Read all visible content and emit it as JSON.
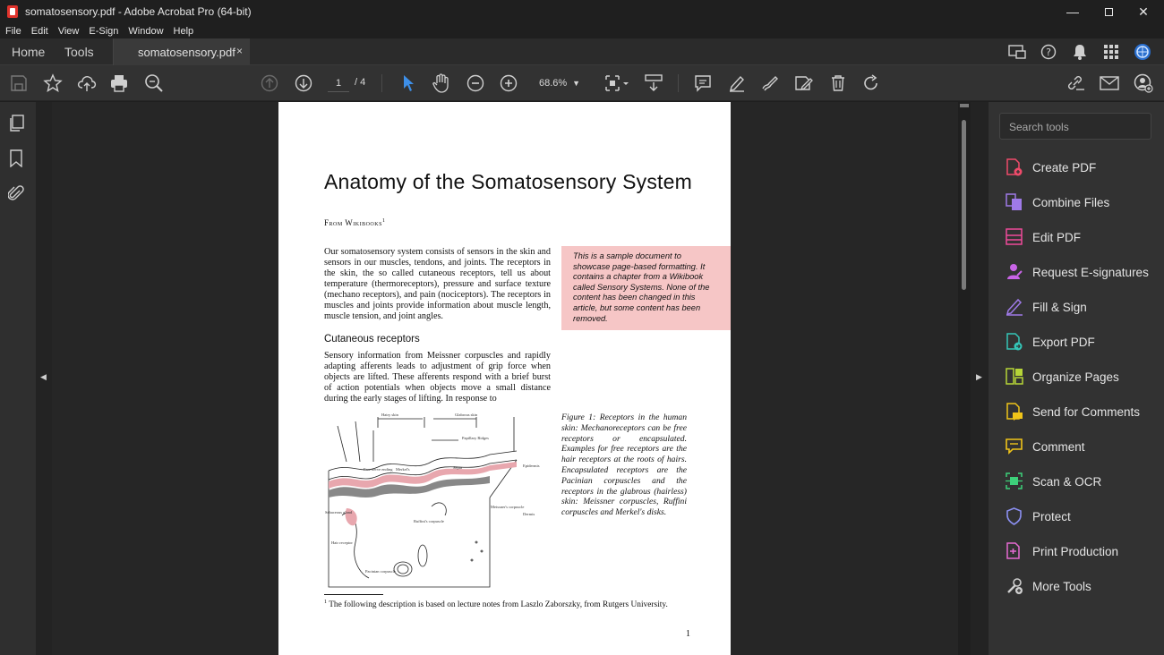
{
  "window": {
    "title": "somatosensory.pdf - Adobe Acrobat Pro (64-bit)"
  },
  "menu": [
    "File",
    "Edit",
    "View",
    "E-Sign",
    "Window",
    "Help"
  ],
  "tabs": {
    "home": "Home",
    "tools": "Tools",
    "document": "somatosensory.pdf",
    "close": "×"
  },
  "toolbar": {
    "page_current": "1",
    "page_total": "/ 4",
    "zoom": "68.6%"
  },
  "right_panel": {
    "search_placeholder": "Search tools",
    "tools": [
      {
        "label": "Create PDF",
        "icon": "create-pdf-icon",
        "color": "#ef4b6b"
      },
      {
        "label": "Combine Files",
        "icon": "combine-files-icon",
        "color": "#9f7ae8"
      },
      {
        "label": "Edit PDF",
        "icon": "edit-pdf-icon",
        "color": "#ef4b9a"
      },
      {
        "label": "Request E-signatures",
        "icon": "e-signature-icon",
        "color": "#c864e6"
      },
      {
        "label": "Fill & Sign",
        "icon": "fill-sign-icon",
        "color": "#9f7ae8"
      },
      {
        "label": "Export PDF",
        "icon": "export-pdf-icon",
        "color": "#34c6b8"
      },
      {
        "label": "Organize Pages",
        "icon": "organize-pages-icon",
        "color": "#b6d438"
      },
      {
        "label": "Send for Comments",
        "icon": "send-comments-icon",
        "color": "#f0c419"
      },
      {
        "label": "Comment",
        "icon": "comment-icon",
        "color": "#f0c419"
      },
      {
        "label": "Scan & OCR",
        "icon": "scan-ocr-icon",
        "color": "#3dd17a"
      },
      {
        "label": "Protect",
        "icon": "protect-icon",
        "color": "#8b8ff0"
      },
      {
        "label": "Print Production",
        "icon": "print-production-icon",
        "color": "#e66ad2"
      },
      {
        "label": "More Tools",
        "icon": "more-tools-icon",
        "color": "#cfcfcf"
      }
    ]
  },
  "document": {
    "title": "Anatomy of the Somatosensory System",
    "from": "From Wikibooks",
    "from_sup": "1",
    "intro": "Our somatosensory system consists of sensors in the skin and sensors in our muscles, tendons, and joints. The receptors in the skin, the so called cutaneous receptors, tell us about temperature (thermoreceptors), pressure and surface texture (mechano receptors), and pain (nociceptors). The receptors in muscles and joints provide information about muscle length, muscle tension, and joint angles.",
    "note": "This is a sample document to showcase page-based formatting. It contains a chapter from a Wikibook called Sensory Systems. None of the content has been changed in this article, but some content has been removed.",
    "section_heading": "Cutaneous receptors",
    "section_text": "Sensory information from Meissner corpuscles and rapidly adapting afferents leads to adjustment of grip force when objects are lifted. These afferents respond with a brief burst of action potentials when objects move a small distance during the early stages of lifting. In response to",
    "figure_caption": "Figure 1: Receptors in the human skin: Mechanoreceptors can be free receptors or encapsulated. Examples for free receptors are the hair receptors at the roots of hairs. Encapsulated receptors are the Pacinian corpuscles and the receptors in the glabrous (hairless) skin: Meissner corpuscles, Ruffini corpuscles and Merkel's disks.",
    "figure_labels": {
      "hairy": "Hairy skin",
      "glabrous": "Glabrous skin",
      "papillary": "Papillary Ridges",
      "epidermis": "Epidermis",
      "dermis": "Dermis",
      "free_nerve": "Free nerve ending",
      "merkel": "Merkel's",
      "septa": "Septa",
      "sebaceous": "Sebaceous gland",
      "ruffini": "Ruffini's corpuscle",
      "meissner": "Meissner's corpuscle",
      "hair_receptor": "Hair receptor",
      "pacinian": "Pacinian corpuscle"
    },
    "footnote_mark": "1",
    "footnote": "The following description is based on lecture notes from Laszlo Zaborszky, from Rutgers University.",
    "page_number": "1"
  }
}
